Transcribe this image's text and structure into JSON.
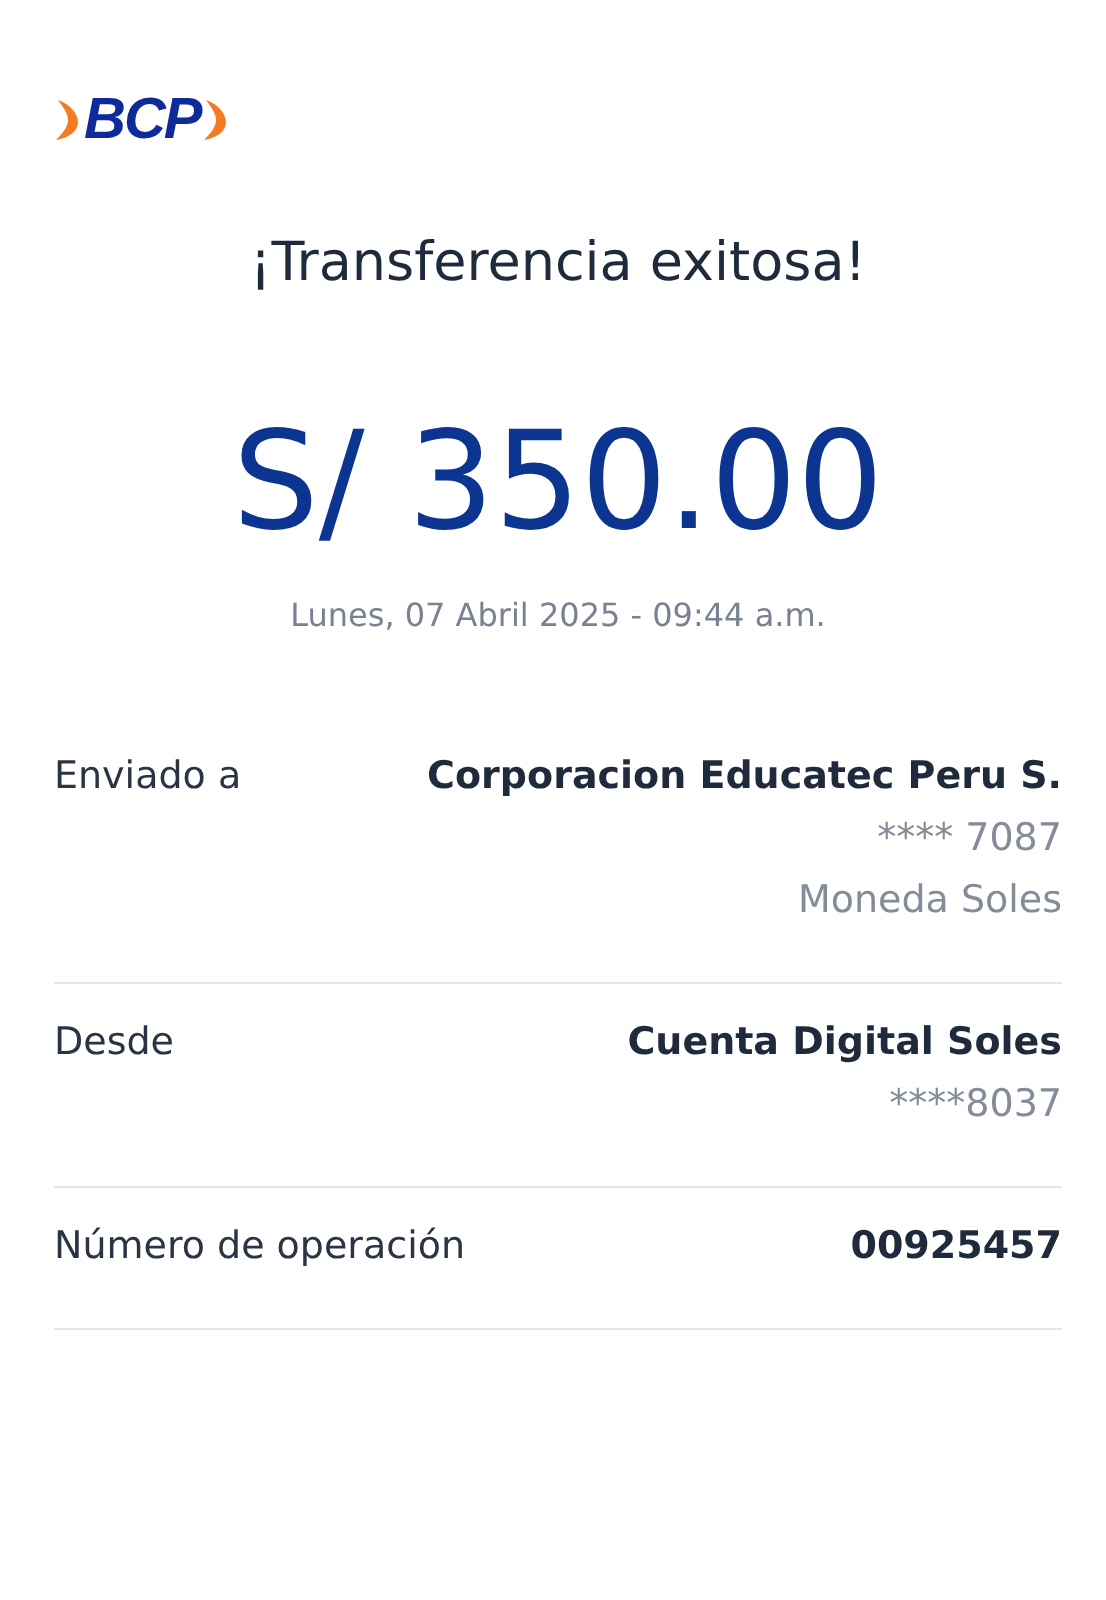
{
  "logo": {
    "text": "BCP"
  },
  "title": "¡Transferencia exitosa!",
  "amount": "S/ 350.00",
  "datetime": "Lunes, 07 Abril 2025 - 09:44 a.m.",
  "details": [
    {
      "label": "Enviado a",
      "lines": [
        "Corporacion Educatec Peru S.",
        "**** 7087",
        "Moneda Soles"
      ]
    },
    {
      "label": "Desde",
      "lines": [
        "Cuenta Digital Soles",
        "****8037"
      ]
    },
    {
      "label": "Número de operación",
      "lines": [
        "00925457"
      ]
    }
  ]
}
